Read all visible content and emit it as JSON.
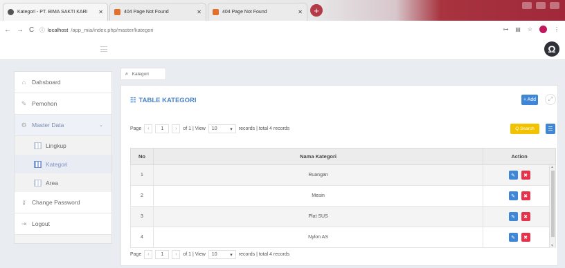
{
  "browser": {
    "tabs": [
      {
        "title": "Kategori - PT. BIMA SAKTI KARI",
        "active": true
      },
      {
        "title": "404 Page Not Found",
        "active": false
      },
      {
        "title": "404 Page Not Found",
        "active": false
      }
    ],
    "url_prefix": "localhost",
    "url_path": "/app_mia/index.php/master/kategori",
    "new_tab": "+"
  },
  "sidebar": {
    "items": [
      {
        "label": "Dahsboard",
        "icon": "home-icon"
      },
      {
        "label": "Pemohon",
        "icon": "pencil-icon"
      },
      {
        "label": "Master Data",
        "icon": "settings-icon"
      },
      {
        "label": "Change Password",
        "icon": "key-icon"
      },
      {
        "label": "Logout",
        "icon": "logout-icon"
      }
    ],
    "subitems": [
      {
        "label": "Lingkup"
      },
      {
        "label": "Kategori"
      },
      {
        "label": "Area"
      }
    ]
  },
  "breadcrumb": {
    "home_icon": "#",
    "current": "Kategori"
  },
  "panel": {
    "title": "TABLE KATEGORI",
    "add_label": "+ Add",
    "search_label": "Q Search"
  },
  "pager": {
    "page_label": "Page",
    "page_value": "1",
    "of_label": "of 1 | View",
    "view_value": "10",
    "records_label": "records | total 4 records"
  },
  "table": {
    "headers": [
      "No",
      "Nama Kategori",
      "Action"
    ],
    "rows": [
      {
        "no": "1",
        "name": "Ruangan"
      },
      {
        "no": "2",
        "name": "Mesin"
      },
      {
        "no": "3",
        "name": "Plat SUS"
      },
      {
        "no": "4",
        "name": "Nylon AS"
      }
    ]
  },
  "colors": {
    "accent": "#3f86d6",
    "danger": "#e5334b",
    "warning": "#f2c200",
    "title": "#4a84c8"
  }
}
